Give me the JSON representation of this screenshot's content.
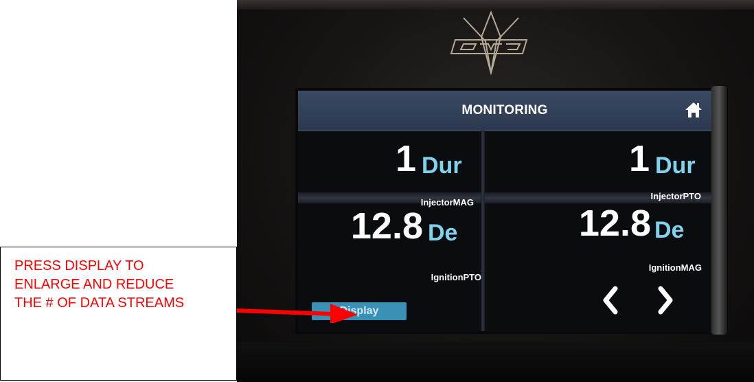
{
  "device": {
    "logo_icon": "evp-logo-icon",
    "screen": {
      "title": "MONITORING",
      "home_icon": "home-icon",
      "cells": [
        {
          "value": "1",
          "unit": "Dur",
          "label": "InjectorMAG"
        },
        {
          "value": "1",
          "unit": "Dur",
          "label": "InjectorPTO"
        },
        {
          "value": "12.8",
          "unit": "De",
          "label": "IgnitionPTO"
        },
        {
          "value": "12.8",
          "unit": "De",
          "label": "IgnitionMAG"
        }
      ],
      "display_button_label": "Display",
      "prev_icon": "chevron-left-icon",
      "next_icon": "chevron-right-icon"
    }
  },
  "annotation": {
    "lines": [
      "PRESS DISPLAY TO",
      "ENLARGE AND REDUCE",
      "THE # OF DATA STREAMS"
    ],
    "arrow_color": "#ff0000"
  },
  "colors": {
    "titlebar": "#2b3850",
    "value_text": "#ffffff",
    "unit_text": "#7fd3ea",
    "display_button": "#3a91b5",
    "annotation_text": "#ff0000"
  }
}
